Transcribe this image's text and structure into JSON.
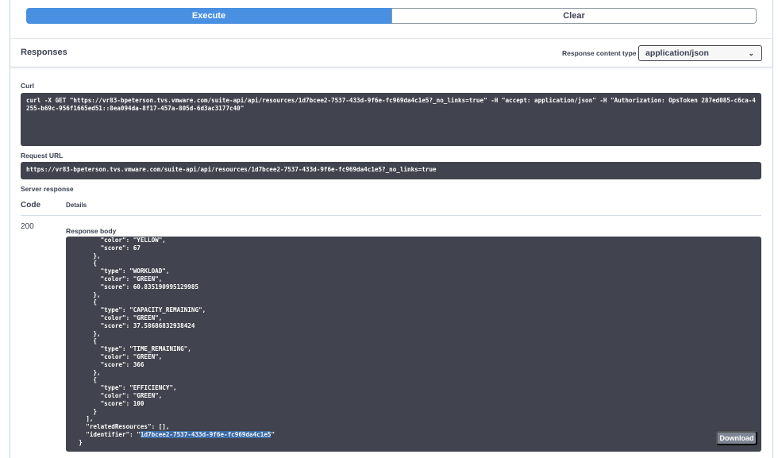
{
  "actions": {
    "execute_label": "Execute",
    "clear_label": "Clear"
  },
  "responses": {
    "title": "Responses",
    "content_type_label": "Response content type",
    "content_type_value": "application/json"
  },
  "curl": {
    "label": "Curl",
    "command": "curl -X GET \"https://vr83-bpeterson.tvs.vmware.com/suite-api/api/resources/1d7bcee2-7537-433d-9f6e-fc969da4c1e5?_no_links=true\" -H \"accept: application/json\" -H \"Authorization: OpsToken 287ed085-c6ca-4255-b69c-956f1665ed51::8ea094da-8f17-457a-805d-6d3ac3177c40\""
  },
  "request_url": {
    "label": "Request URL",
    "value": "https://vr83-bpeterson.tvs.vmware.com/suite-api/api/resources/1d7bcee2-7537-433d-9f6e-fc969da4c1e5?_no_links=true"
  },
  "server_response": {
    "label": "Server response",
    "code_header": "Code",
    "details_header": "Details",
    "status_code": "200",
    "body_label": "Response body",
    "body_lines": [
      "        \"color\": \"YELLOW\",",
      "        \"score\": 67",
      "      },",
      "      {",
      "        \"type\": \"WORKLOAD\",",
      "        \"color\": \"GREEN\",",
      "        \"score\": 60.835190995129985",
      "      },",
      "      {",
      "        \"type\": \"CAPACITY_REMAINING\",",
      "        \"color\": \"GREEN\",",
      "        \"score\": 37.58686832938424",
      "      },",
      "      {",
      "        \"type\": \"TIME_REMAINING\",",
      "        \"color\": \"GREEN\",",
      "        \"score\": 366",
      "      },",
      "      {",
      "        \"type\": \"EFFICIENCY\",",
      "        \"color\": \"GREEN\",",
      "        \"score\": 100",
      "      }",
      "    ],",
      "    \"relatedResources\": [],"
    ],
    "identifier_prefix": "    \"identifier\": \"",
    "identifier_value": "1d7bcee2-7537-433d-9f6e-fc969da4c1e5",
    "identifier_suffix": "\"",
    "closing_line": "  }",
    "download_label": "Download"
  }
}
